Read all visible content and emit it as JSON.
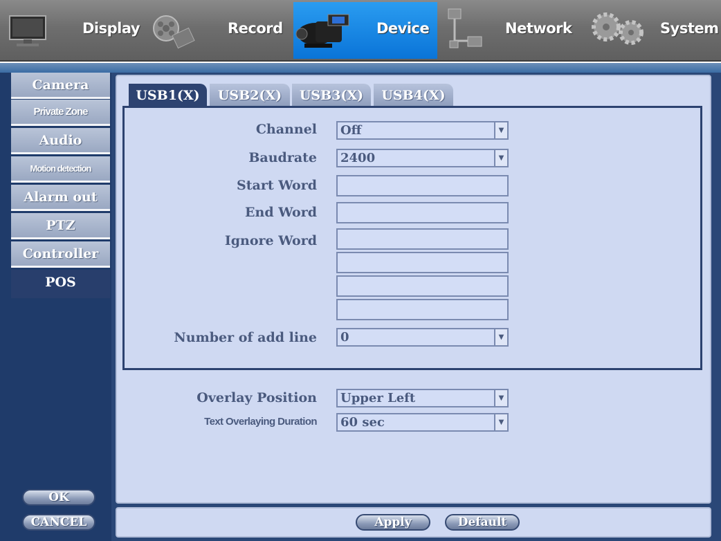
{
  "top_menu": [
    {
      "label": "Display",
      "icon": "monitor-icon"
    },
    {
      "label": "Record",
      "icon": "film-reel-icon"
    },
    {
      "label": "Device",
      "icon": "video-camera-icon",
      "active": true
    },
    {
      "label": "Network",
      "icon": "network-icon"
    },
    {
      "label": "System",
      "icon": "gears-icon"
    }
  ],
  "sidebar": {
    "items": [
      {
        "label": "Camera"
      },
      {
        "label": "Private Zone"
      },
      {
        "label": "Audio"
      },
      {
        "label": "Motion detection"
      },
      {
        "label": "Alarm out"
      },
      {
        "label": "PTZ"
      },
      {
        "label": "Controller"
      },
      {
        "label": "POS",
        "active": true
      }
    ],
    "ok_label": "OK",
    "cancel_label": "CANCEL"
  },
  "usb_tabs": [
    {
      "label": "USB1(X)",
      "active": true
    },
    {
      "label": "USB2(X)"
    },
    {
      "label": "USB3(X)"
    },
    {
      "label": "USB4(X)"
    }
  ],
  "form": {
    "channel": {
      "label": "Channel",
      "value": "Off"
    },
    "baudrate": {
      "label": "Baudrate",
      "value": "2400"
    },
    "start_word": {
      "label": "Start Word",
      "value": ""
    },
    "end_word": {
      "label": "End Word",
      "value": ""
    },
    "ignore_word": {
      "label": "Ignore Word",
      "values": [
        "",
        "",
        "",
        ""
      ]
    },
    "add_line": {
      "label": "Number of add line",
      "value": "0"
    },
    "overlay_position": {
      "label": "Overlay Position",
      "value": "Upper Left"
    },
    "overlay_duration": {
      "label": "Text Overlaying Duration",
      "value": "60 sec"
    }
  },
  "bottom": {
    "apply_label": "Apply",
    "default_label": "Default"
  },
  "colors": {
    "active_tab": "#0a74d8",
    "panel_bg": "#cfd9f2",
    "frame": "#2a4777"
  }
}
